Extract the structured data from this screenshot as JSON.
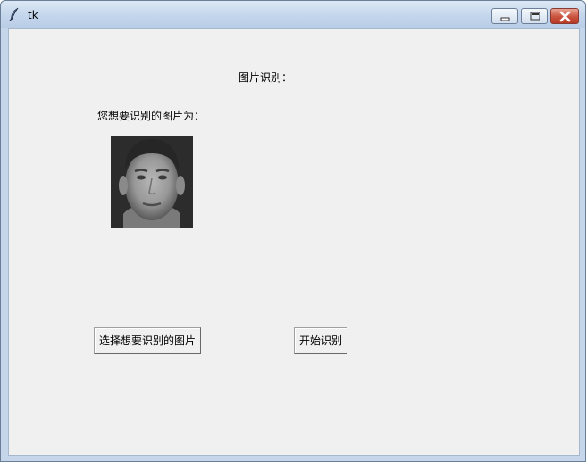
{
  "window": {
    "title": "tk",
    "icon": "feather-icon",
    "controls": [
      "minimize-icon",
      "maximize-icon",
      "close-icon"
    ]
  },
  "main": {
    "heading": "图片识别：",
    "prompt_label": "您想要识别的图片为：",
    "preview_image": "grayscale face photo",
    "select_button_label": "选择想要识别的图片",
    "start_button_label": "开始识别"
  }
}
